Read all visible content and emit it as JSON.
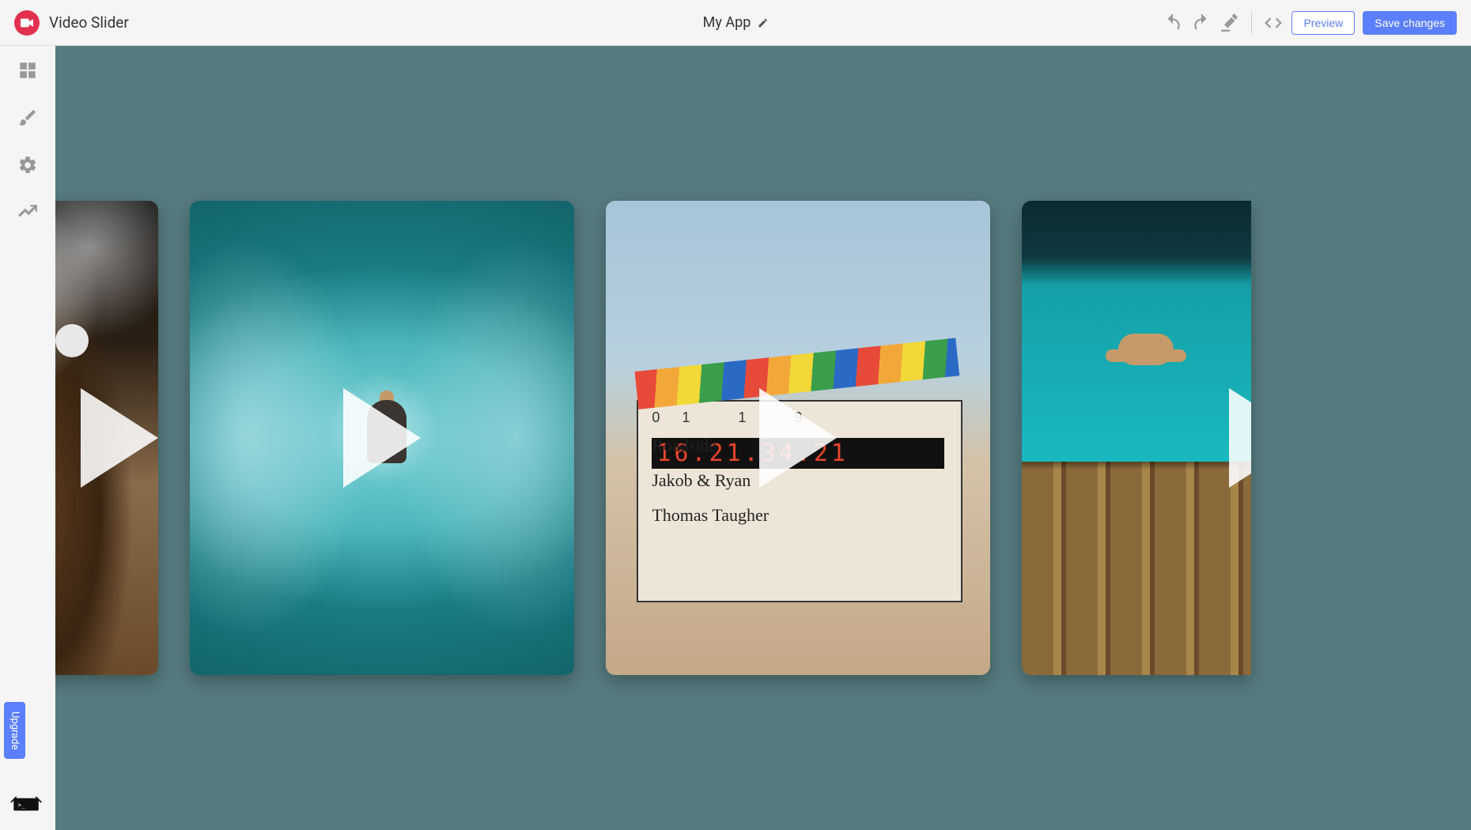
{
  "header": {
    "page_title": "Video Slider",
    "app_name": "My App",
    "preview_label": "Preview",
    "save_label": "Save changes"
  },
  "sidebar": {
    "upgrade_label": "Upgrade"
  },
  "slider": {
    "cards": [
      {
        "name": "horse-racing-video",
        "alt": "Horse racing jockeys"
      },
      {
        "name": "surfing-video",
        "alt": "Surfer inside wave barrel"
      },
      {
        "name": "clapperboard-video",
        "alt": "Film clapperboard in desert",
        "slate": {
          "scene_numbers": "01  1  9",
          "timecode": "16.21.34.21",
          "line1": "Roadside",
          "line2": "Jakob & Ryan",
          "line3": "Thomas Taugher"
        }
      },
      {
        "name": "cliff-dive-video",
        "alt": "Person diving into turquoise water"
      }
    ]
  }
}
